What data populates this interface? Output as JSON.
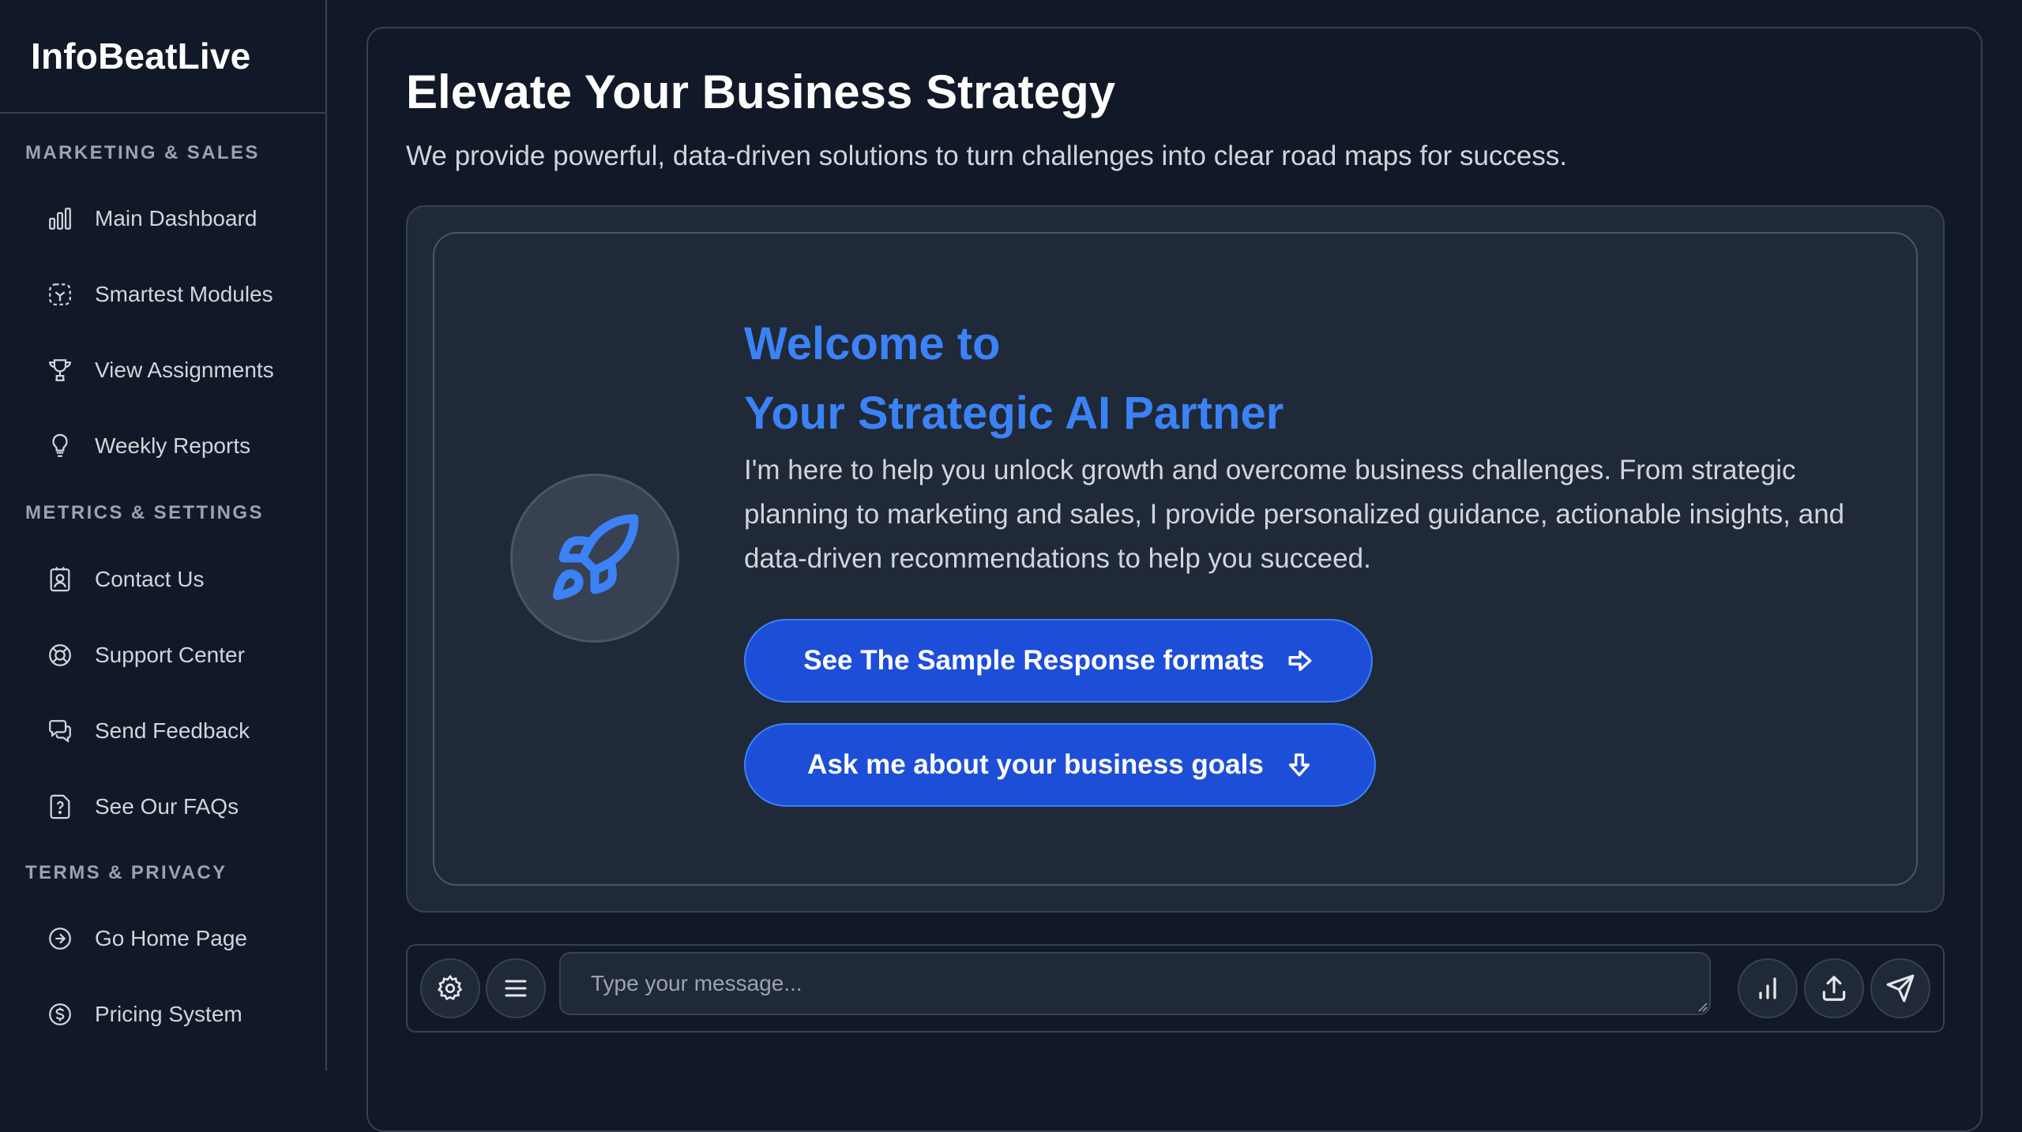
{
  "brand": "InfoBeatLive",
  "sidebar": {
    "sections": [
      {
        "title": "MARKETING & SALES",
        "items": [
          {
            "label": "Main Dashboard",
            "icon": "bar-chart-icon"
          },
          {
            "label": "Smartest Modules",
            "icon": "modules-icon"
          },
          {
            "label": "View Assignments",
            "icon": "trophy-icon"
          },
          {
            "label": "Weekly Reports",
            "icon": "lightbulb-icon"
          }
        ]
      },
      {
        "title": "METRICS & SETTINGS",
        "items": [
          {
            "label": "Contact Us",
            "icon": "contact-card-icon"
          },
          {
            "label": "Support Center",
            "icon": "lifebuoy-icon"
          },
          {
            "label": "Send Feedback",
            "icon": "chat-bubbles-icon"
          },
          {
            "label": "See Our FAQs",
            "icon": "question-file-icon"
          }
        ]
      },
      {
        "title": "TERMS & PRIVACY",
        "items": [
          {
            "label": "Go Home Page",
            "icon": "arrow-circle-icon"
          },
          {
            "label": "Pricing System",
            "icon": "dollar-circle-icon"
          }
        ]
      }
    ]
  },
  "main": {
    "title": "Elevate Your Business Strategy",
    "subtitle": "We provide powerful, data-driven solutions to turn challenges into clear road maps for success.",
    "welcome_line1": "Welcome to",
    "welcome_line2": "Your Strategic AI Partner",
    "description": "I'm here to help you unlock growth and overcome business challenges. From strategic planning to marketing and sales, I provide personalized guidance, actionable insights, and data-driven recommendations to help you succeed.",
    "buttons": {
      "sample_formats": "See The Sample Response formats",
      "business_goals": "Ask me about your business goals"
    }
  },
  "chat": {
    "placeholder": "Type your message...",
    "value": ""
  },
  "colors": {
    "background": "#111827",
    "panel": "#1f2937",
    "border": "#374151",
    "accent": "#3b82f6",
    "button": "#1d4ed8"
  }
}
